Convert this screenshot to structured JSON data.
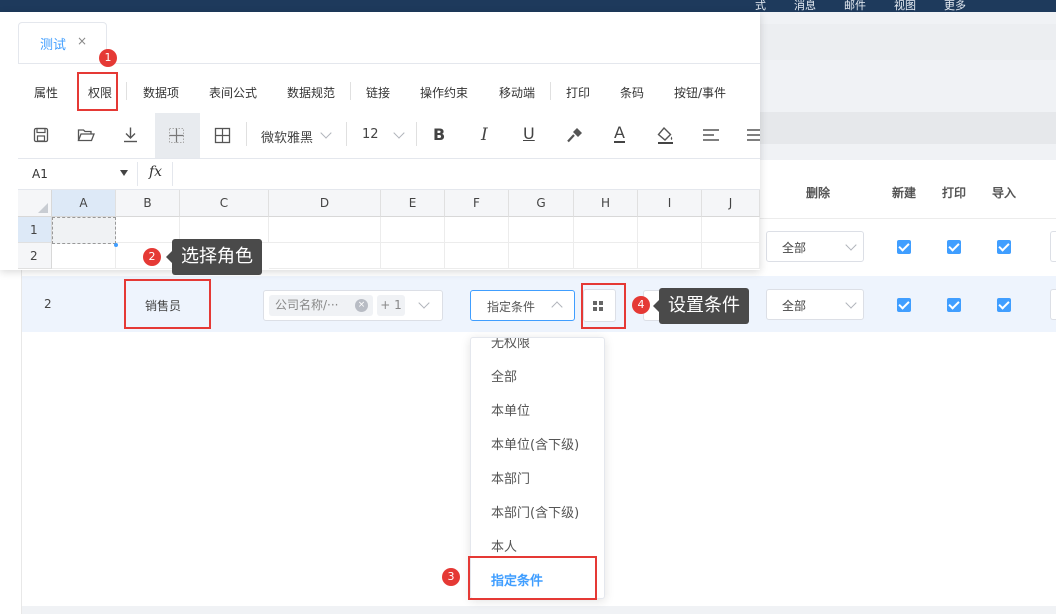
{
  "top_menu": [
    "式",
    "消息",
    "邮件",
    "视图",
    "更多"
  ],
  "tab": {
    "label": "测试",
    "close": "×"
  },
  "menu_items": [
    "属性",
    "权限",
    "数据项",
    "表间公式",
    "数据规范",
    "链接",
    "操作约束",
    "移动端",
    "打印",
    "条码",
    "按钮/事件"
  ],
  "toolbar": {
    "font_name": "微软雅黑",
    "font_size": "12",
    "bold": "B",
    "italic": "I",
    "underline": "U",
    "font_color": "A"
  },
  "formula_bar": {
    "cell_ref": "A1",
    "fx": "fx"
  },
  "columns": [
    "A",
    "B",
    "C",
    "D",
    "E",
    "F",
    "G",
    "H",
    "I",
    "J"
  ],
  "rows": [
    "1",
    "2"
  ],
  "perm_headers": [
    "删除",
    "新建",
    "打印",
    "导入"
  ],
  "perm_row": {
    "number": "2",
    "role": "销售员",
    "field_chip": "公司名称/···",
    "field_close": "×",
    "field_count": "+ 1",
    "condition": "指定条件",
    "delete_scope": "全部"
  },
  "row1": {
    "delete_scope": "全部"
  },
  "dropdown_options": [
    "无权限",
    "全部",
    "本单位",
    "本单位(含下级)",
    "本部门",
    "本部门(含下级)",
    "本人",
    "指定条件"
  ],
  "annotations": {
    "step1": "1",
    "step2": "2",
    "step2_text": "选择角色",
    "step3": "3",
    "step4": "4",
    "step4_text": "设置条件"
  },
  "colors": {
    "accent": "#409eff",
    "annotation": "#e53935",
    "topbar": "#1e3a5c"
  }
}
